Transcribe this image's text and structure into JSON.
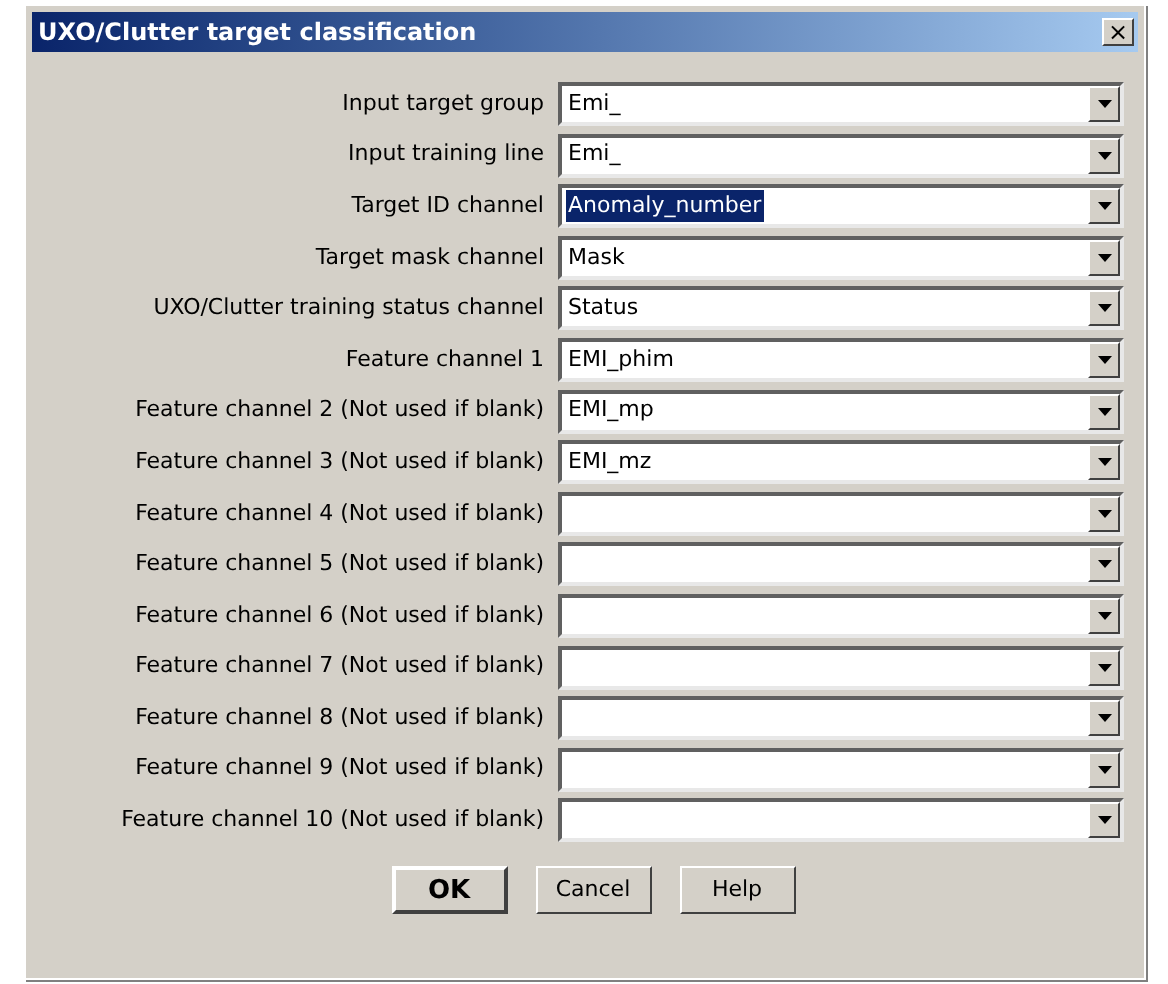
{
  "window": {
    "title": "UXO/Clutter target classification",
    "close": "×"
  },
  "fields": [
    {
      "label": "Input target group",
      "value": "Emi_",
      "highlighted": false
    },
    {
      "label": "Input training line",
      "value": "Emi_",
      "highlighted": false
    },
    {
      "label": "Target ID channel",
      "value": "Anomaly_number",
      "highlighted": true
    },
    {
      "label": "Target mask channel",
      "value": "Mask",
      "highlighted": false
    },
    {
      "label": "UXO/Clutter training status channel",
      "value": "Status",
      "highlighted": false
    },
    {
      "label": "Feature channel 1",
      "value": "EMI_phim",
      "highlighted": false
    },
    {
      "label": "Feature channel 2 (Not used if blank)",
      "value": "EMI_mp",
      "highlighted": false
    },
    {
      "label": "Feature channel 3 (Not used if blank)",
      "value": "EMI_mz",
      "highlighted": false
    },
    {
      "label": "Feature channel 4 (Not used if blank)"
    },
    {
      "label": "Feature channel 5 (Not used if blank)"
    },
    {
      "label": "Feature channel 6 (Not used if blank)"
    },
    {
      "label": "Feature channel 7 (Not used if blank)"
    },
    {
      "label": "Feature channel 8 (Not used if blank)"
    },
    {
      "label": "Feature channel 9 (Not used if blank)"
    },
    {
      "label": "Feature channel 10 (Not used if blank)"
    }
  ],
  "buttons": [
    {
      "label": "OK",
      "default": true
    },
    {
      "label": "Cancel",
      "default": false
    },
    {
      "label": "Help",
      "default": false
    }
  ]
}
